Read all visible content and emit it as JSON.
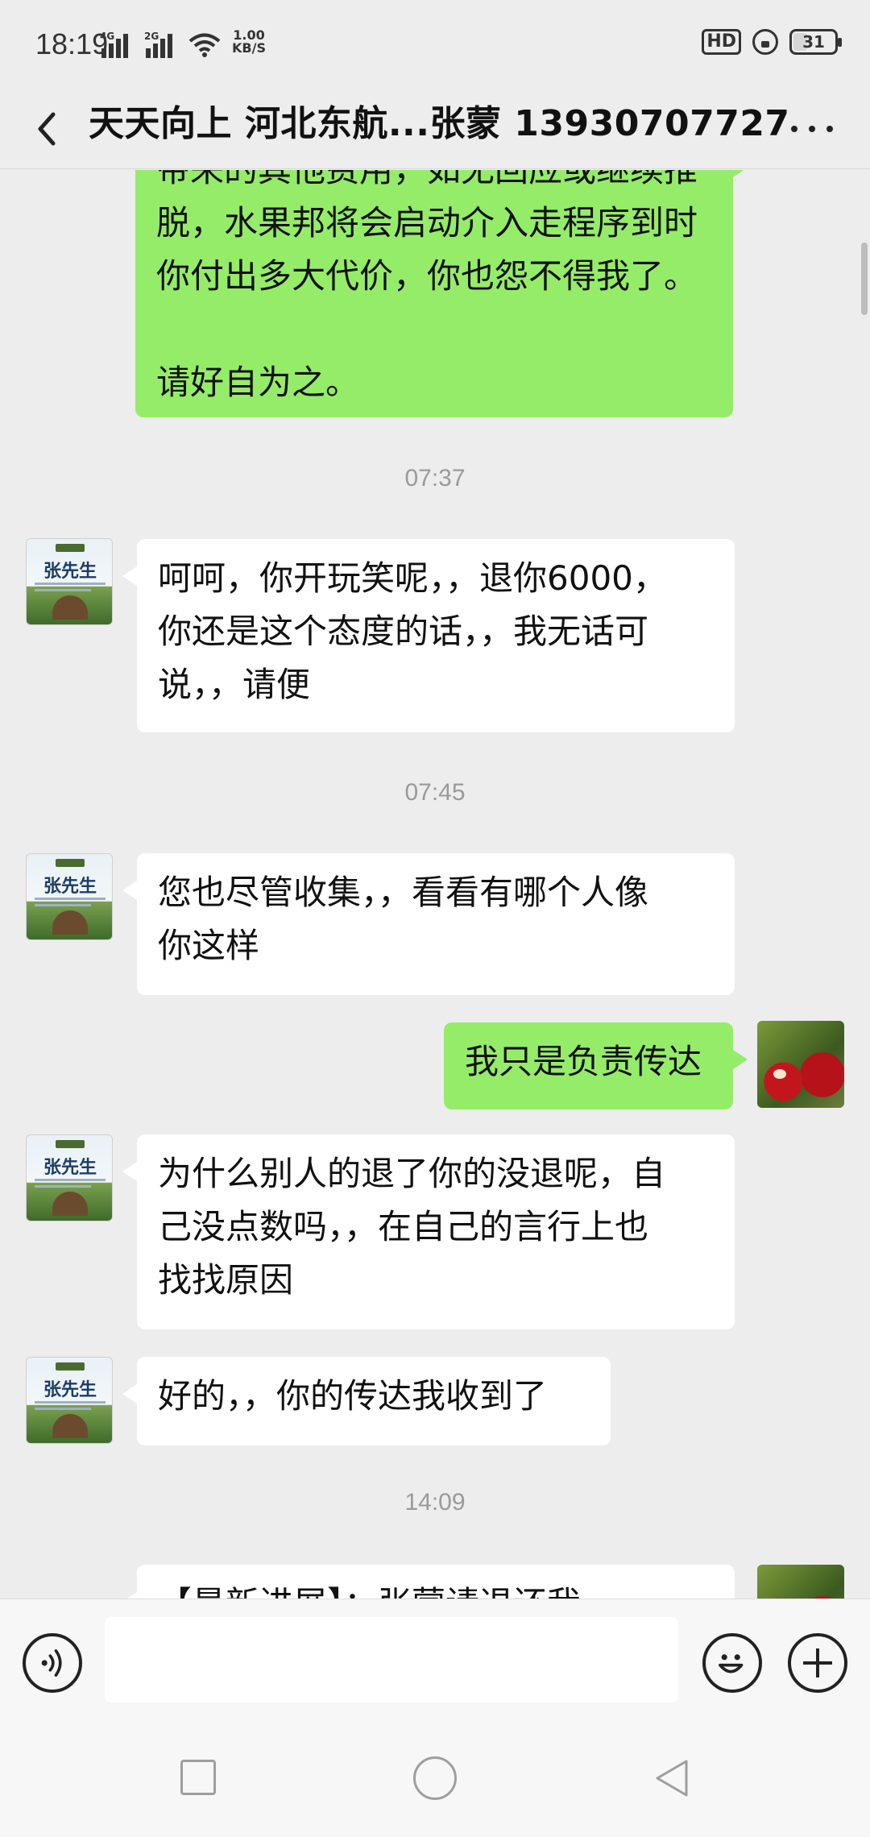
{
  "status_bar": {
    "time": "18:19",
    "net1": "4G",
    "net2": "2G",
    "speed_value": "1.00",
    "speed_unit": "KB/S",
    "hd_label": "HD",
    "battery": "31",
    "battery_level": 0.31
  },
  "header": {
    "title": "天天向上 河北东航...张蒙 13930707727"
  },
  "messages": [
    {
      "side": "out",
      "text": "带来的其他费用，如无回应或继续推\n脱，水果邦将会启动介入走程序到时\n你付出多大代价，你也怨不得我了。\n\n请好自为之。"
    },
    {
      "time": "07:37"
    },
    {
      "side": "in",
      "avatar_name": "张先生",
      "text": "呵呵，你开玩笑呢，，退你6000，\n你还是这个态度的话，，我无话可\n说，，请便"
    },
    {
      "time": "07:45"
    },
    {
      "side": "in",
      "avatar_name": "张先生",
      "text": "您也尽管收集，，看看有哪个人像\n你这样"
    },
    {
      "side": "out",
      "text": "我只是负责传达"
    },
    {
      "side": "in",
      "avatar_name": "张先生",
      "text": "为什么别人的退了你的没退呢，自\n己没点数吗，，在自己的言行上也\n找找原因"
    },
    {
      "side": "in",
      "avatar_name": "张先生",
      "text": "好的，，你的传达我收到了"
    },
    {
      "time": "14:09"
    },
    {
      "side": "out",
      "text": "【最新进展】：张蒙请退还我"
    }
  ],
  "input": {
    "placeholder": ""
  },
  "icons": {
    "back": "back-arrow-icon",
    "more": "more-dots-icon",
    "voice": "voice-icon",
    "emoji": "emoji-icon",
    "plus": "plus-icon"
  },
  "colors": {
    "background": "#ededed",
    "bubble_out": "#95ec69",
    "bubble_in": "#ffffff",
    "timestamp": "#9a9a9a"
  }
}
